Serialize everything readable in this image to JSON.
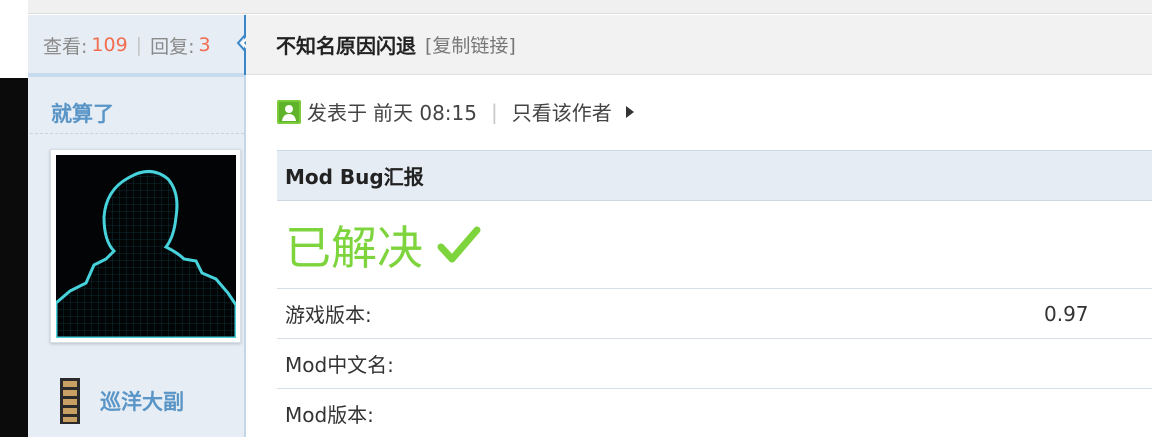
{
  "thread": {
    "views_label": "查看:",
    "views": "109",
    "replies_label": "回复:",
    "replies": "3",
    "separator": "|",
    "title": "不知名原因闪退",
    "copy_link": "[复制链接]"
  },
  "author": {
    "name": "就算了",
    "rank": "巡洋大副"
  },
  "post": {
    "posted_prefix": "发表于",
    "posted_time": "前天 08:15",
    "separator": "|",
    "only_author": "只看该作者"
  },
  "report": {
    "header": "Mod Bug汇报",
    "status": "已解决",
    "status_mark": "✔",
    "rows": [
      {
        "label": "游戏版本:",
        "value": "0.97"
      },
      {
        "label": "Mod中文名:",
        "value": ""
      },
      {
        "label": "Mod版本:",
        "value": ""
      }
    ]
  },
  "colors": {
    "accent_blue": "#5a95c7",
    "count_orange": "#f26c4f",
    "resolved_green": "#7ed43c",
    "sidebar_bg": "#e6edf4"
  },
  "icons": [
    "online-status-icon",
    "checkmark-icon",
    "play-triangle-icon",
    "rank-ladder-icon"
  ]
}
